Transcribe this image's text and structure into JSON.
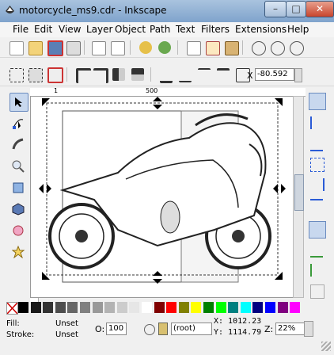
{
  "window": {
    "title": "motorcycle_ms9.cdr - Inkscape",
    "min_glyph": "–",
    "max_glyph": "□",
    "close_glyph": "✕"
  },
  "menu": [
    "File",
    "Edit",
    "View",
    "Layer",
    "Object",
    "Path",
    "Text",
    "Filters",
    "Extensions",
    "Help"
  ],
  "toolbar_icons": [
    "new-icon",
    "open-icon",
    "save-icon",
    "print-icon",
    "import-icon",
    "export-icon",
    "undo-icon",
    "redo-icon",
    "copy-icon",
    "cut-icon",
    "paste-icon",
    "zoom-selection-icon",
    "zoom-drawing-icon",
    "zoom-page-icon"
  ],
  "align_icons": [
    "select-all-icon",
    "select-in-all-layers-icon",
    "deselect-icon",
    "rotate-ccw-icon",
    "rotate-cw-icon",
    "flip-horizontal-icon",
    "flip-vertical-icon",
    "lower-to-bottom-icon",
    "lower-icon",
    "raise-icon",
    "raise-to-top-icon"
  ],
  "coords_bar": {
    "x_label": "X",
    "x_value": "-80.592"
  },
  "ruler": {
    "mark1": "1",
    "mark500": "500"
  },
  "tools": [
    "selector-tool-icon",
    "node-tool-icon",
    "tweak-tool-icon",
    "zoom-tool-icon",
    "rectangle-tool-icon",
    "3d-box-tool-icon",
    "circle-tool-icon",
    "star-tool-icon"
  ],
  "palette": [
    "#000000",
    "#1a1a1a",
    "#333333",
    "#4d4d4d",
    "#666666",
    "#808080",
    "#999999",
    "#b3b3b3",
    "#cccccc",
    "#e6e6e6",
    "#ffffff",
    "#800000",
    "#ff0000",
    "#808000",
    "#ffff00",
    "#008000",
    "#00ff00",
    "#008080",
    "#00ffff",
    "#000080",
    "#0000ff",
    "#800080",
    "#ff00ff"
  ],
  "status": {
    "fill_label": "Fill:",
    "fill_value": "Unset",
    "stroke_label": "Stroke:",
    "stroke_value": "Unset",
    "opacity_label": "O:",
    "opacity_value": "100",
    "layer_value": "(root)",
    "x_coord": "X: 1012.23",
    "y_coord": "Y: 1114.79",
    "zoom_label": "Z:",
    "zoom_value": "22%"
  }
}
